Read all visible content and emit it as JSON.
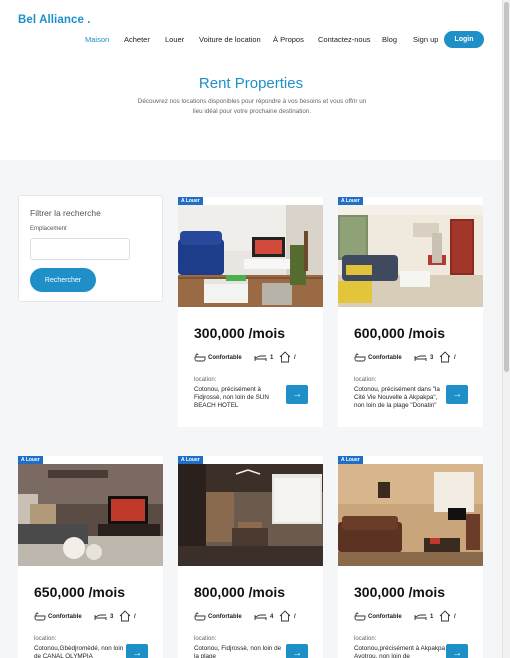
{
  "brand": {
    "name": "Bel Alliance ."
  },
  "nav": {
    "items": [
      "Maison",
      "Acheter",
      "Louer",
      "Voiture de location",
      "À Propos",
      "Contactez-nous",
      "Blog",
      "Sign up"
    ],
    "login": "Login"
  },
  "hero": {
    "title": "Rent Properties",
    "subtitle": "Découvrez nos locations disponibles pour répondre à vos besoins et vous offrir un lieu idéal pour votre prochaine destination."
  },
  "filter": {
    "title": "Filtrer la recherche",
    "location_label": "Emplacement",
    "location_value": "",
    "search_button": "Rechercher"
  },
  "listings": [
    {
      "badge": "A Louer",
      "price": "300,000 /mois",
      "comfort": "Confortable",
      "beds": "1",
      "extra": "/",
      "location_label": "location:",
      "location": "Cotonou, précisément à Fidjrossè, non loin de SUN BEACH HOTEL"
    },
    {
      "badge": "A Louer",
      "price": "600,000 /mois",
      "comfort": "Confortable",
      "beds": "3",
      "extra": "/",
      "location_label": "location:",
      "location": "Cotonou, précisément dans \"la Cité Vie Nouvelle à Akpakpa\", non loin de la plage \"Donatin\""
    },
    {
      "badge": "A Louer",
      "price": "650,000 /mois",
      "comfort": "Confortable",
      "beds": "3",
      "extra": "/",
      "location_label": "location:",
      "location": "Cotonou,Gbèdjromèdé, non loin de CANAL OLYMPIA"
    },
    {
      "badge": "A Louer",
      "price": "800,000 /mois",
      "comfort": "Confortable",
      "beds": "4",
      "extra": "/",
      "location_label": "location:",
      "location": "Cotonou, Fidjrossè, non loin de la plage"
    },
    {
      "badge": "A Louer",
      "price": "300,000 /mois",
      "comfort": "Confortable",
      "beds": "1",
      "extra": "/",
      "location_label": "location:",
      "location": "Cotonou,précisément à Akpakpa Avotrou, non loin de"
    }
  ],
  "colors": {
    "accent": "#1f8fc8",
    "badge": "#1f6fc8",
    "page_bg": "#f5f6f8"
  },
  "icons": {
    "bath": "bathtub-icon",
    "bed": "bed-icon",
    "house": "house-icon",
    "arrow": "arrow-right-icon"
  }
}
